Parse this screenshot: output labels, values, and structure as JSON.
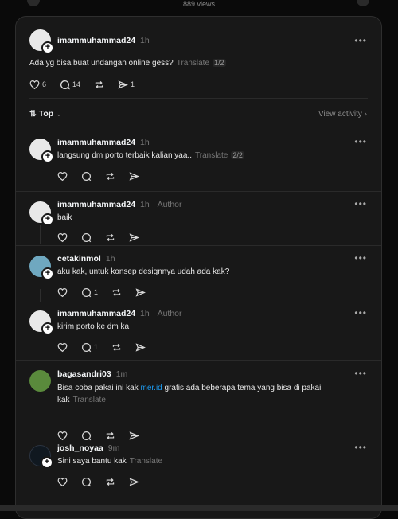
{
  "header": {
    "views": "889 views"
  },
  "main_post": {
    "username": "imammuhammad24",
    "time": "1h",
    "text": "Ada yg bisa buat undangan online gess?",
    "translate": "Translate",
    "page": "1/2",
    "likes": "6",
    "replies": "14",
    "shares": "1"
  },
  "sort": {
    "label": "Top",
    "icons": [
      "sort-arrows-icon",
      "chevron-down-icon"
    ],
    "view_activity": "View activity"
  },
  "posts": [
    {
      "username": "imammuhammad24",
      "time": "1h",
      "author": "",
      "text": "langsung dm porto terbaik kalian yaa..",
      "translate": "Translate",
      "page": "2/2",
      "reply_count": ""
    },
    {
      "username": "imammuhammad24",
      "time": "1h",
      "author": "· Author",
      "text": "baik",
      "translate": "",
      "page": "",
      "reply_count": ""
    },
    {
      "username": "cetakinmol",
      "time": "1h",
      "author": "",
      "text": "aku kak, untuk konsep designnya udah ada kak?",
      "translate": "",
      "page": "",
      "reply_count": "1"
    },
    {
      "username": "imammuhammad24",
      "time": "1h",
      "author": "· Author",
      "text": "kirim porto ke dm ka",
      "translate": "",
      "page": "",
      "reply_count": "1"
    },
    {
      "username": "bagasandri03",
      "time": "1m",
      "author": "",
      "text_before": "Bisa coba pakai ini kak ",
      "link": "mer.id",
      "text_after": " gratis ada beberapa tema yang bisa di pakai kak",
      "translate": "Translate",
      "reply_count": ""
    },
    {
      "username": "josh_noyaa",
      "time": "9m",
      "author": "",
      "text": "Sini saya bantu kak",
      "translate": "Translate",
      "reply_count": ""
    }
  ],
  "more_label": "•••",
  "plus_label": "+",
  "colors": {
    "background": "#0a0a0a",
    "card": "#181818",
    "link": "#1d9bf0",
    "muted": "#777777"
  }
}
